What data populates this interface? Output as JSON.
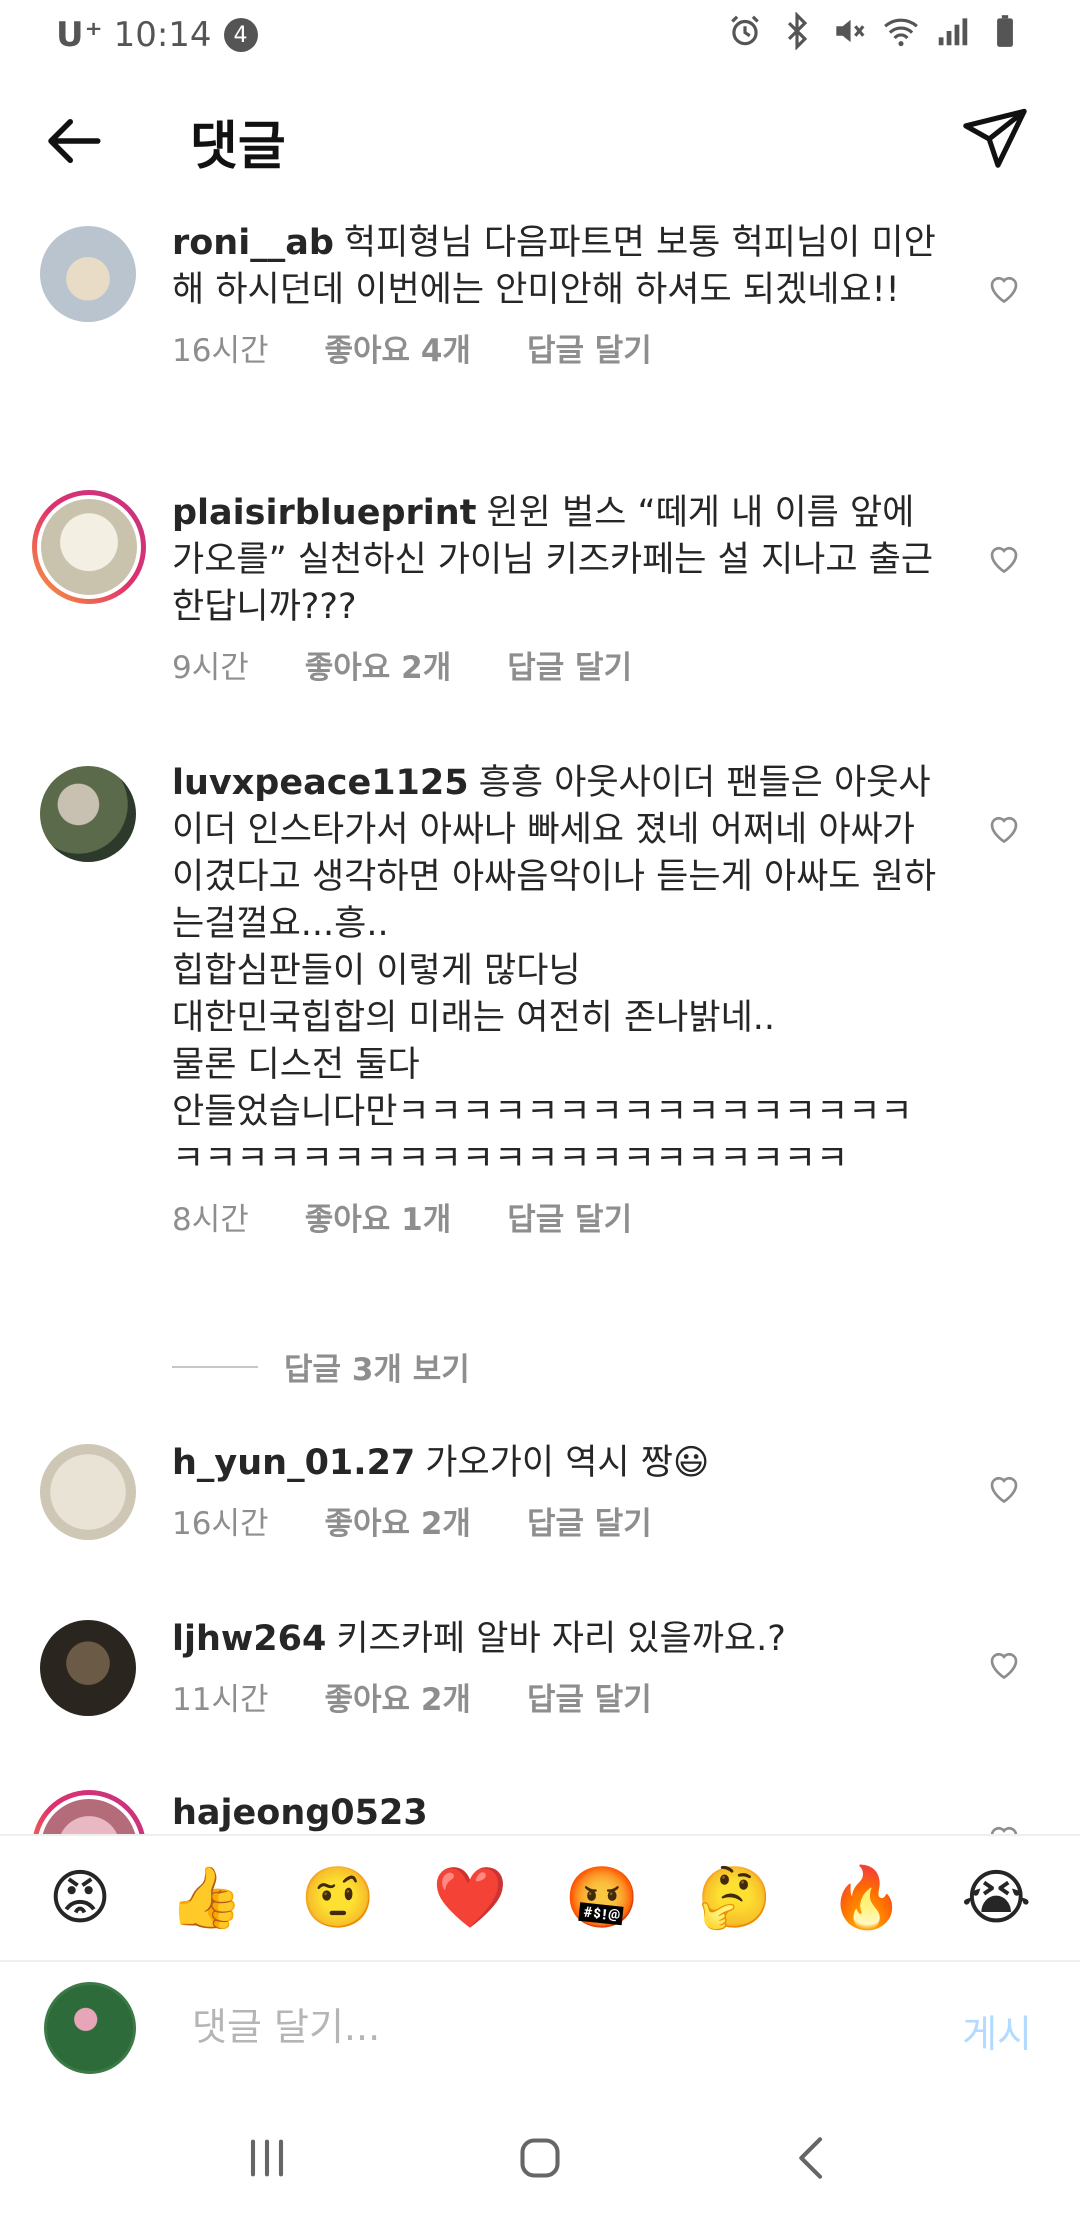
{
  "status_bar": {
    "carrier": "U⁺",
    "time": "10:14",
    "notification_count": "4"
  },
  "header": {
    "title": "댓글"
  },
  "comments": [
    {
      "username": "roni__ab",
      "text": "헉피형님 다음파트면 보통 헉피님이 미안해 하시던데 이번에는 안미안해 하셔도 되겠네요!!",
      "time": "16시간",
      "likes": "좋아요 4개",
      "reply": "답글 달기"
    },
    {
      "username": "plaisirblueprint",
      "text": "윈윈 벌스 “떼게 내 이름 앞에 가오를” 실천하신 가이님 키즈카페는 설 지나고 출근 한답니까???",
      "time": "9시간",
      "likes": "좋아요 2개",
      "reply": "답글 달기"
    },
    {
      "username": "luvxpeace1125",
      "text": "흥흥 아웃사이더 팬들은 아웃사이더 인스타가서 아싸나 빠세요 졌네 어쩌네 아싸가 이겼다고 생각하면 아싸음악이나 듣는게 아싸도 원하는걸껄요...흥..\n힙합심판들이 이렇게 많다닝\n대한민국힙합의 미래는 여전히 존나밝네..\n물론 디스전 둘다\n안들었습니다만ㅋㅋㅋㅋㅋㅋㅋㅋㅋㅋㅋㅋㅋㅋㅋㅋㅋㅋㅋㅋㅋㅋㅋㅋㅋㅋㅋㅋㅋㅋㅋㅋㅋㅋㅋㅋㅋ",
      "time": "8시간",
      "likes": "좋아요 1개",
      "reply": "답글 달기"
    },
    {
      "username": "h_yun_01.27",
      "text": "가오가이 역시 짱😃",
      "time": "16시간",
      "likes": "좋아요 2개",
      "reply": "답글 달기"
    },
    {
      "username": "ljhw264",
      "text": "키즈카페 알바 자리 있을까요.?",
      "time": "11시간",
      "likes": "좋아요 2개",
      "reply": "답글 달기"
    },
    {
      "username": "hajeong0523",
      "text": ""
    }
  ],
  "view_replies_label": "답글 3개 보기",
  "emoji_bar": [
    "😡",
    "👍",
    "🤨",
    "❤️",
    "🤬",
    "🤔",
    "🔥",
    "😭"
  ],
  "comment_input": {
    "placeholder": "댓글 달기...",
    "post_label": "게시"
  },
  "colors": {
    "username": "#262626",
    "meta": "#8e8e8e",
    "post_disabled": "#b3dbff",
    "story_ring": "#e1306c"
  }
}
